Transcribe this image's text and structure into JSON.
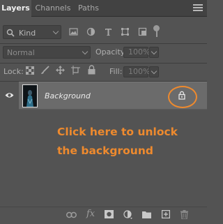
{
  "tabs": [
    {
      "label": "Layers",
      "active": true
    },
    {
      "label": "Channels",
      "active": false
    },
    {
      "label": "Paths",
      "active": false
    }
  ],
  "filter": {
    "kind_label": "Kind",
    "icons": [
      "image-filter-icon",
      "adjustment-filter-icon",
      "type-filter-icon",
      "shape-filter-icon",
      "smart-object-filter-icon",
      "filter-toggle-icon"
    ]
  },
  "blend": {
    "mode": "Normal",
    "opacity_label": "Opacity:",
    "opacity_value": "100%"
  },
  "locks": {
    "label": "Lock:",
    "fill_label": "Fill:",
    "fill_value": "100%"
  },
  "layer": {
    "name": "Background",
    "visible": true,
    "locked": true
  },
  "annotation": {
    "line1": "Click here to unlock",
    "line2": "the background",
    "color": "#ee8a2e"
  },
  "bottom_icons": [
    "link-icon",
    "fx-icon",
    "mask-icon",
    "adjustment-icon",
    "folder-icon",
    "new-layer-icon",
    "trash-icon"
  ],
  "bottom_fx_label": "fx"
}
